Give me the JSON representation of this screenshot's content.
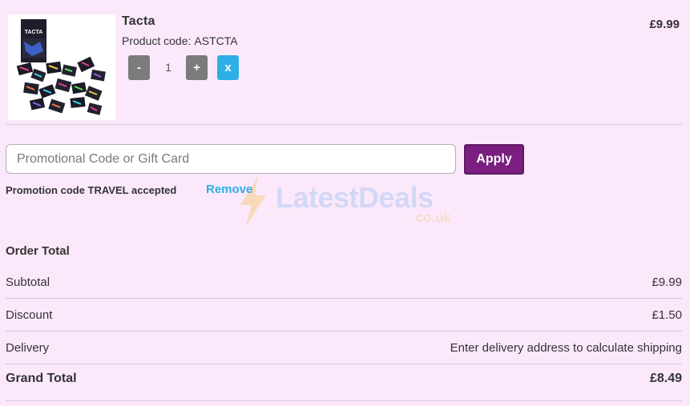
{
  "product": {
    "name": "Tacta",
    "code_label": "Product code:",
    "code": "ASTCTA",
    "price": "£9.99",
    "box_title": "TACTA",
    "quantity": "1",
    "decrease_label": "-",
    "increase_label": "+",
    "remove_label": "x"
  },
  "promo": {
    "placeholder": "Promotional Code or Gift Card",
    "value": "",
    "apply_label": "Apply",
    "status": "Promotion code TRAVEL accepted",
    "remove_label": "Remove"
  },
  "watermark": {
    "text": "LatestDeals",
    "sub": ".co.uk"
  },
  "order": {
    "title": "Order Total",
    "rows": [
      {
        "label": "Subtotal",
        "value": "£9.99"
      },
      {
        "label": "Discount",
        "value": "£1.50"
      },
      {
        "label": "Delivery",
        "value": "Enter delivery address to calculate shipping"
      }
    ],
    "grand": {
      "label": "Grand Total",
      "value": "£8.49"
    }
  },
  "colors": {
    "background": "#fbe9fb",
    "apply_button": "#7a1f7f",
    "accent_blue": "#2eaee6",
    "qty_button": "#7b7b7b"
  }
}
